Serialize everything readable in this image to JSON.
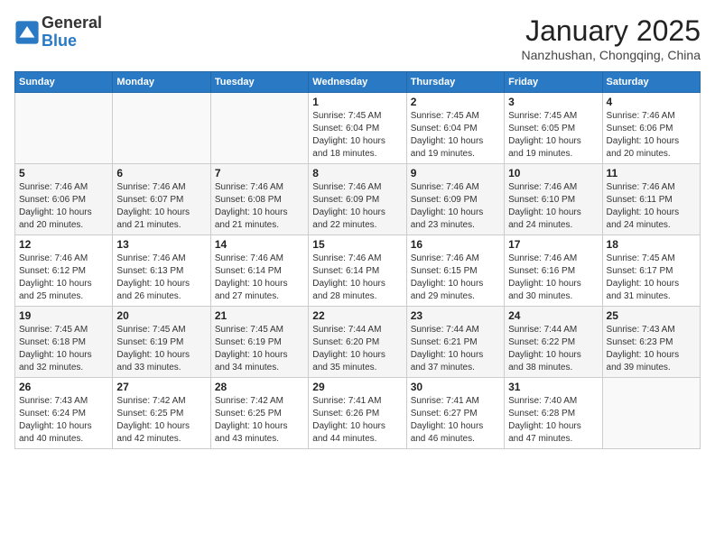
{
  "header": {
    "logo": {
      "general": "General",
      "blue": "Blue"
    },
    "title": "January 2025",
    "location": "Nanzhushan, Chongqing, China"
  },
  "calendar": {
    "days_of_week": [
      "Sunday",
      "Monday",
      "Tuesday",
      "Wednesday",
      "Thursday",
      "Friday",
      "Saturday"
    ],
    "weeks": [
      [
        {
          "day": "",
          "info": ""
        },
        {
          "day": "",
          "info": ""
        },
        {
          "day": "",
          "info": ""
        },
        {
          "day": "1",
          "info": "Sunrise: 7:45 AM\nSunset: 6:04 PM\nDaylight: 10 hours and 18 minutes."
        },
        {
          "day": "2",
          "info": "Sunrise: 7:45 AM\nSunset: 6:04 PM\nDaylight: 10 hours and 19 minutes."
        },
        {
          "day": "3",
          "info": "Sunrise: 7:45 AM\nSunset: 6:05 PM\nDaylight: 10 hours and 19 minutes."
        },
        {
          "day": "4",
          "info": "Sunrise: 7:46 AM\nSunset: 6:06 PM\nDaylight: 10 hours and 20 minutes."
        }
      ],
      [
        {
          "day": "5",
          "info": "Sunrise: 7:46 AM\nSunset: 6:06 PM\nDaylight: 10 hours and 20 minutes."
        },
        {
          "day": "6",
          "info": "Sunrise: 7:46 AM\nSunset: 6:07 PM\nDaylight: 10 hours and 21 minutes."
        },
        {
          "day": "7",
          "info": "Sunrise: 7:46 AM\nSunset: 6:08 PM\nDaylight: 10 hours and 21 minutes."
        },
        {
          "day": "8",
          "info": "Sunrise: 7:46 AM\nSunset: 6:09 PM\nDaylight: 10 hours and 22 minutes."
        },
        {
          "day": "9",
          "info": "Sunrise: 7:46 AM\nSunset: 6:09 PM\nDaylight: 10 hours and 23 minutes."
        },
        {
          "day": "10",
          "info": "Sunrise: 7:46 AM\nSunset: 6:10 PM\nDaylight: 10 hours and 24 minutes."
        },
        {
          "day": "11",
          "info": "Sunrise: 7:46 AM\nSunset: 6:11 PM\nDaylight: 10 hours and 24 minutes."
        }
      ],
      [
        {
          "day": "12",
          "info": "Sunrise: 7:46 AM\nSunset: 6:12 PM\nDaylight: 10 hours and 25 minutes."
        },
        {
          "day": "13",
          "info": "Sunrise: 7:46 AM\nSunset: 6:13 PM\nDaylight: 10 hours and 26 minutes."
        },
        {
          "day": "14",
          "info": "Sunrise: 7:46 AM\nSunset: 6:14 PM\nDaylight: 10 hours and 27 minutes."
        },
        {
          "day": "15",
          "info": "Sunrise: 7:46 AM\nSunset: 6:14 PM\nDaylight: 10 hours and 28 minutes."
        },
        {
          "day": "16",
          "info": "Sunrise: 7:46 AM\nSunset: 6:15 PM\nDaylight: 10 hours and 29 minutes."
        },
        {
          "day": "17",
          "info": "Sunrise: 7:46 AM\nSunset: 6:16 PM\nDaylight: 10 hours and 30 minutes."
        },
        {
          "day": "18",
          "info": "Sunrise: 7:45 AM\nSunset: 6:17 PM\nDaylight: 10 hours and 31 minutes."
        }
      ],
      [
        {
          "day": "19",
          "info": "Sunrise: 7:45 AM\nSunset: 6:18 PM\nDaylight: 10 hours and 32 minutes."
        },
        {
          "day": "20",
          "info": "Sunrise: 7:45 AM\nSunset: 6:19 PM\nDaylight: 10 hours and 33 minutes."
        },
        {
          "day": "21",
          "info": "Sunrise: 7:45 AM\nSunset: 6:19 PM\nDaylight: 10 hours and 34 minutes."
        },
        {
          "day": "22",
          "info": "Sunrise: 7:44 AM\nSunset: 6:20 PM\nDaylight: 10 hours and 35 minutes."
        },
        {
          "day": "23",
          "info": "Sunrise: 7:44 AM\nSunset: 6:21 PM\nDaylight: 10 hours and 37 minutes."
        },
        {
          "day": "24",
          "info": "Sunrise: 7:44 AM\nSunset: 6:22 PM\nDaylight: 10 hours and 38 minutes."
        },
        {
          "day": "25",
          "info": "Sunrise: 7:43 AM\nSunset: 6:23 PM\nDaylight: 10 hours and 39 minutes."
        }
      ],
      [
        {
          "day": "26",
          "info": "Sunrise: 7:43 AM\nSunset: 6:24 PM\nDaylight: 10 hours and 40 minutes."
        },
        {
          "day": "27",
          "info": "Sunrise: 7:42 AM\nSunset: 6:25 PM\nDaylight: 10 hours and 42 minutes."
        },
        {
          "day": "28",
          "info": "Sunrise: 7:42 AM\nSunset: 6:25 PM\nDaylight: 10 hours and 43 minutes."
        },
        {
          "day": "29",
          "info": "Sunrise: 7:41 AM\nSunset: 6:26 PM\nDaylight: 10 hours and 44 minutes."
        },
        {
          "day": "30",
          "info": "Sunrise: 7:41 AM\nSunset: 6:27 PM\nDaylight: 10 hours and 46 minutes."
        },
        {
          "day": "31",
          "info": "Sunrise: 7:40 AM\nSunset: 6:28 PM\nDaylight: 10 hours and 47 minutes."
        },
        {
          "day": "",
          "info": ""
        }
      ]
    ]
  }
}
